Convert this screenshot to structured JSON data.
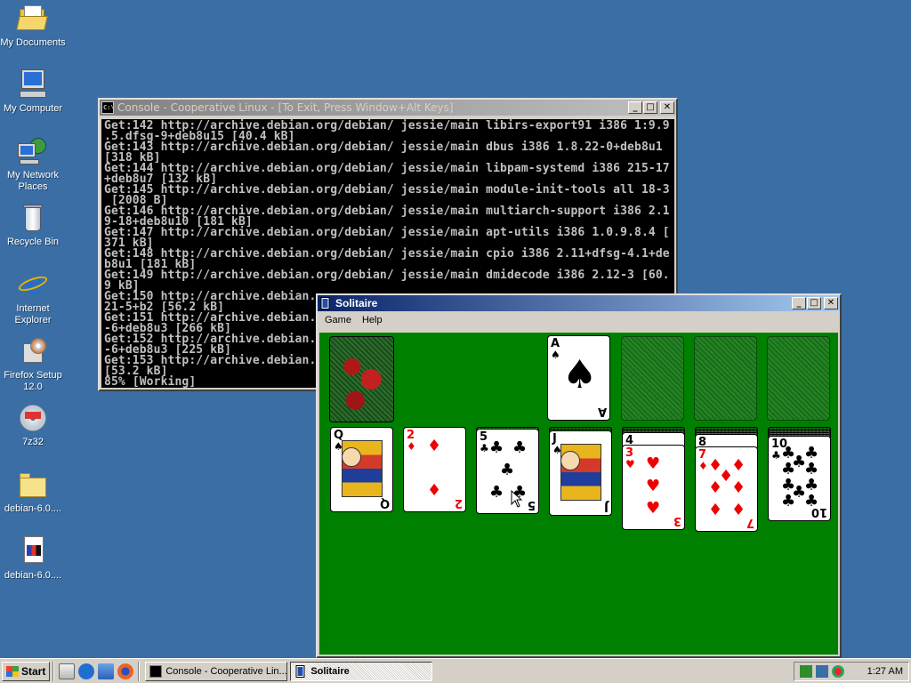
{
  "desktop": {
    "icons": [
      {
        "label": "My Documents",
        "icon": "my-documents-icon"
      },
      {
        "label": "My Computer",
        "icon": "my-computer-icon"
      },
      {
        "label": "My Network Places",
        "icon": "network-places-icon"
      },
      {
        "label": "Recycle Bin",
        "icon": "recycle-bin-icon"
      },
      {
        "label": "Internet Explorer",
        "icon": "internet-explorer-icon"
      },
      {
        "label": "Firefox Setup 12.0",
        "icon": "installer-icon"
      },
      {
        "label": "7z32",
        "icon": "cd-installer-icon"
      },
      {
        "label": "debian-6.0....",
        "icon": "folder-icon"
      },
      {
        "label": "debian-6.0....",
        "icon": "document-icon"
      }
    ]
  },
  "console": {
    "title": "Console - Cooperative Linux - [To Exit, Press Window+Alt Keys]",
    "lines": [
      "Get:142 http://archive.debian.org/debian/ jessie/main libirs-export91 i386 1:9.9",
      ".5.dfsg-9+deb8u15 [40.4 kB]",
      "Get:143 http://archive.debian.org/debian/ jessie/main dbus i386 1.8.22-0+deb8u1",
      "[318 kB]",
      "Get:144 http://archive.debian.org/debian/ jessie/main libpam-systemd i386 215-17",
      "+deb8u7 [132 kB]",
      "Get:145 http://archive.debian.org/debian/ jessie/main module-init-tools all 18-3",
      " [2008 B]",
      "Get:146 http://archive.debian.org/debian/ jessie/main multiarch-support i386 2.1",
      "9-18+deb8u10 [181 kB]",
      "Get:147 http://archive.debian.org/debian/ jessie/main apt-utils i386 1.0.9.8.4 [",
      "371 kB]",
      "Get:148 http://archive.debian.org/debian/ jessie/main cpio i386 2.11+dfsg-4.1+de",
      "b8u1 [181 kB]",
      "Get:149 http://archive.debian.org/debian/ jessie/main dmidecode i386 2.12-3 [60.",
      "9 kB]",
      "Get:150 http://archive.debian.",
      "21-5+b2 [56.2 kB]",
      "Get:151 http://archive.debian.",
      "-6+deb8u3 [266 kB]",
      "Get:152 http://archive.debian.",
      "-6+deb8u3 [225 kB]",
      "Get:153 http://archive.debian.",
      "[53.2 kB]",
      "85% [Working]"
    ]
  },
  "solitaire": {
    "title": "Solitaire",
    "menu": [
      "Game",
      "Help"
    ],
    "foundation": {
      "rank": "A",
      "suit": "♠",
      "color": "black"
    },
    "tableau": [
      {
        "rank": "Q",
        "suit": "♠",
        "color": "black",
        "face": true
      },
      {
        "rank": "2",
        "suit": "♦",
        "color": "red"
      },
      {
        "rank": "5",
        "suit": "♣",
        "color": "black"
      },
      {
        "rank": "J",
        "suit": "♠",
        "color": "black",
        "face": true
      },
      {
        "rank": "3",
        "suit": "♥",
        "color": "red",
        "under_rank": "4",
        "under_suit": "♠"
      },
      {
        "rank": "7",
        "suit": "♦",
        "color": "red",
        "under_rank": "8",
        "under_suit": "♠"
      },
      {
        "rank": "10",
        "suit": "♣",
        "color": "black"
      }
    ]
  },
  "taskbar": {
    "start_label": "Start",
    "tasks": [
      {
        "label": "Console - Cooperative Lin...",
        "active": false
      },
      {
        "label": "Solitaire",
        "active": true
      }
    ],
    "clock": "1:27 AM"
  }
}
